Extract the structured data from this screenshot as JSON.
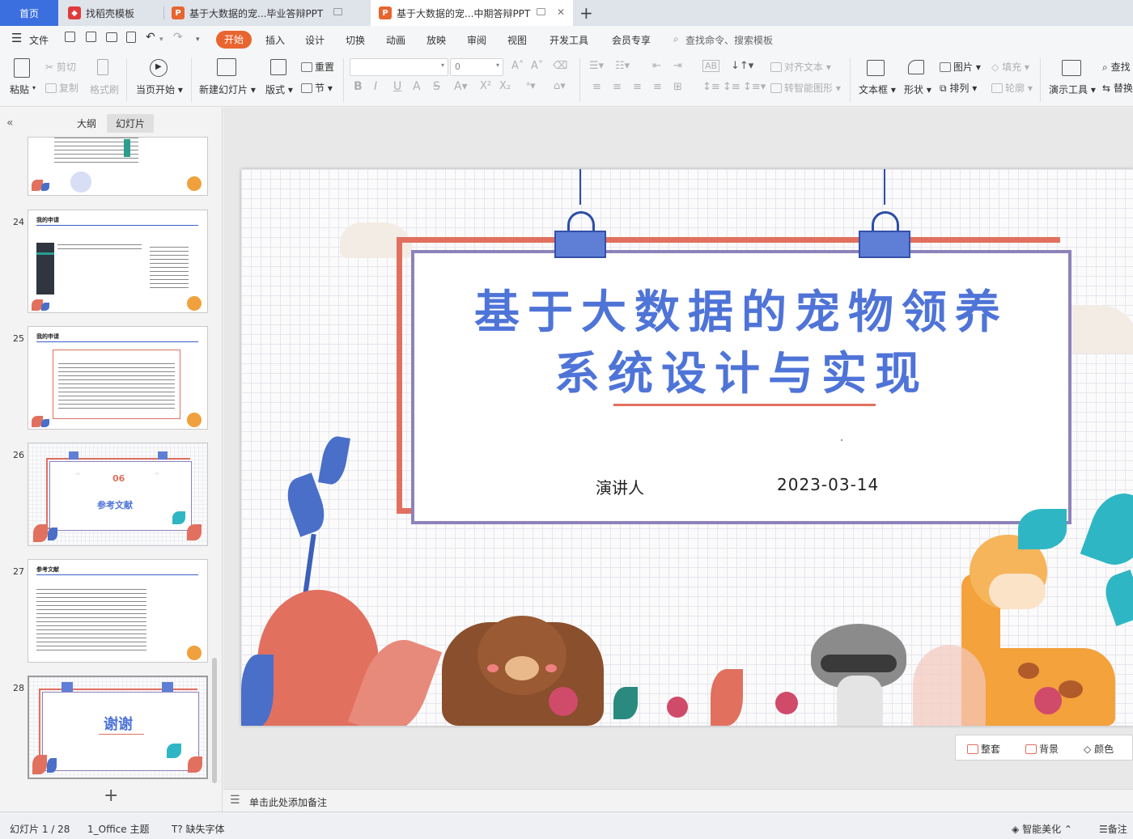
{
  "tabs": {
    "home": "首页",
    "items": [
      {
        "label": "找稻壳模板"
      },
      {
        "label": "基于大数据的宠...毕业答辩PPT"
      },
      {
        "label": "基于大数据的宠...中期答辩PPT"
      }
    ],
    "new_tab": "+"
  },
  "menu": {
    "file": "文件",
    "items": [
      "开始",
      "插入",
      "设计",
      "切换",
      "动画",
      "放映",
      "审阅",
      "视图",
      "开发工具",
      "会员专享"
    ],
    "search": "查找命令、搜索模板"
  },
  "ribbon": {
    "paste": "粘贴",
    "cut": "剪切",
    "copy": "复制",
    "format_painter": "格式刷",
    "from_current": "当页开始",
    "new_slide": "新建幻灯片",
    "layout": "版式",
    "reset": "重置",
    "section": "节",
    "font_size": "0",
    "align_text": "对齐文本",
    "smart_art": "转智能图形",
    "textbox": "文本框",
    "shape": "形状",
    "picture": "图片",
    "arrange": "排列",
    "fill": "填充",
    "outline": "轮廓",
    "present_tools": "演示工具",
    "find": "查找",
    "replace": "替换"
  },
  "panel": {
    "tab_outline": "大纲",
    "tab_slides": "幻灯片",
    "thumbs": [
      {
        "num": "24",
        "title": "我的申请"
      },
      {
        "num": "25",
        "title": "我的申请"
      },
      {
        "num": "26",
        "badge": "06",
        "title": "参考文献"
      },
      {
        "num": "27",
        "title": "参考文献"
      },
      {
        "num": "28",
        "title": "谢谢"
      }
    ],
    "add": "+"
  },
  "slide": {
    "title_line1": "基于大数据的宠物领养",
    "title_line2": "系统设计与实现",
    "presenter_label": "演讲人",
    "date": "2023-03-14"
  },
  "slide_tools": {
    "tidy": "整套",
    "background": "背景",
    "color": "颜色"
  },
  "notes": {
    "placeholder": "单击此处添加备注"
  },
  "status": {
    "slide_count": "幻灯片 1 / 28",
    "theme": "1_Office 主题",
    "missing_font": "缺失字体",
    "smart_beautify": "智能美化",
    "notes": "备注"
  },
  "colors": {
    "accent_blue": "#3b6fe0",
    "start_orange": "#e8652f",
    "title_blue": "#4f74d8",
    "frame_red": "#e1705f",
    "frame_purple": "#8e82bc"
  }
}
